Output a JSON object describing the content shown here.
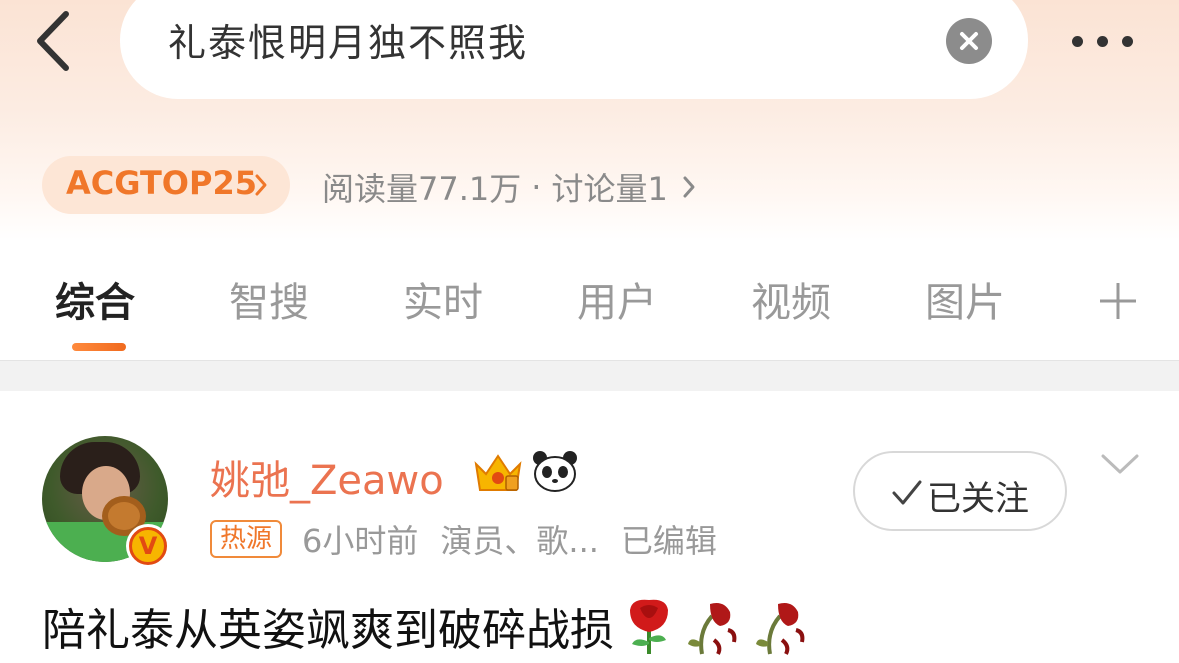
{
  "search": {
    "query": "礼泰恨明月独不照我",
    "back_icon": "chevron-left-icon",
    "clear_icon": "close-circle-icon",
    "more_icon": "more-dots-icon"
  },
  "topic": {
    "rank_label": "ACGTOP25",
    "reads": "阅读量77.1万",
    "separator": "·",
    "discussions": "讨论量1"
  },
  "tabs": [
    {
      "label": "综合",
      "active": true
    },
    {
      "label": "智搜",
      "active": false
    },
    {
      "label": "实时",
      "active": false
    },
    {
      "label": "用户",
      "active": false
    },
    {
      "label": "视频",
      "active": false
    },
    {
      "label": "图片",
      "active": false
    }
  ],
  "post": {
    "username": "姚弛_Zeawo",
    "verified_mark": "V",
    "badge": "热源",
    "time": "6小时前",
    "tags": "演员、歌...",
    "edited": "已编辑",
    "follow_label": "已关注",
    "text": "陪礼泰从英姿飒爽到破碎战损"
  },
  "colors": {
    "accent_orange": "#f0772a",
    "username_color": "#eb7350",
    "header_gradient_top": "#fbe3d4"
  }
}
